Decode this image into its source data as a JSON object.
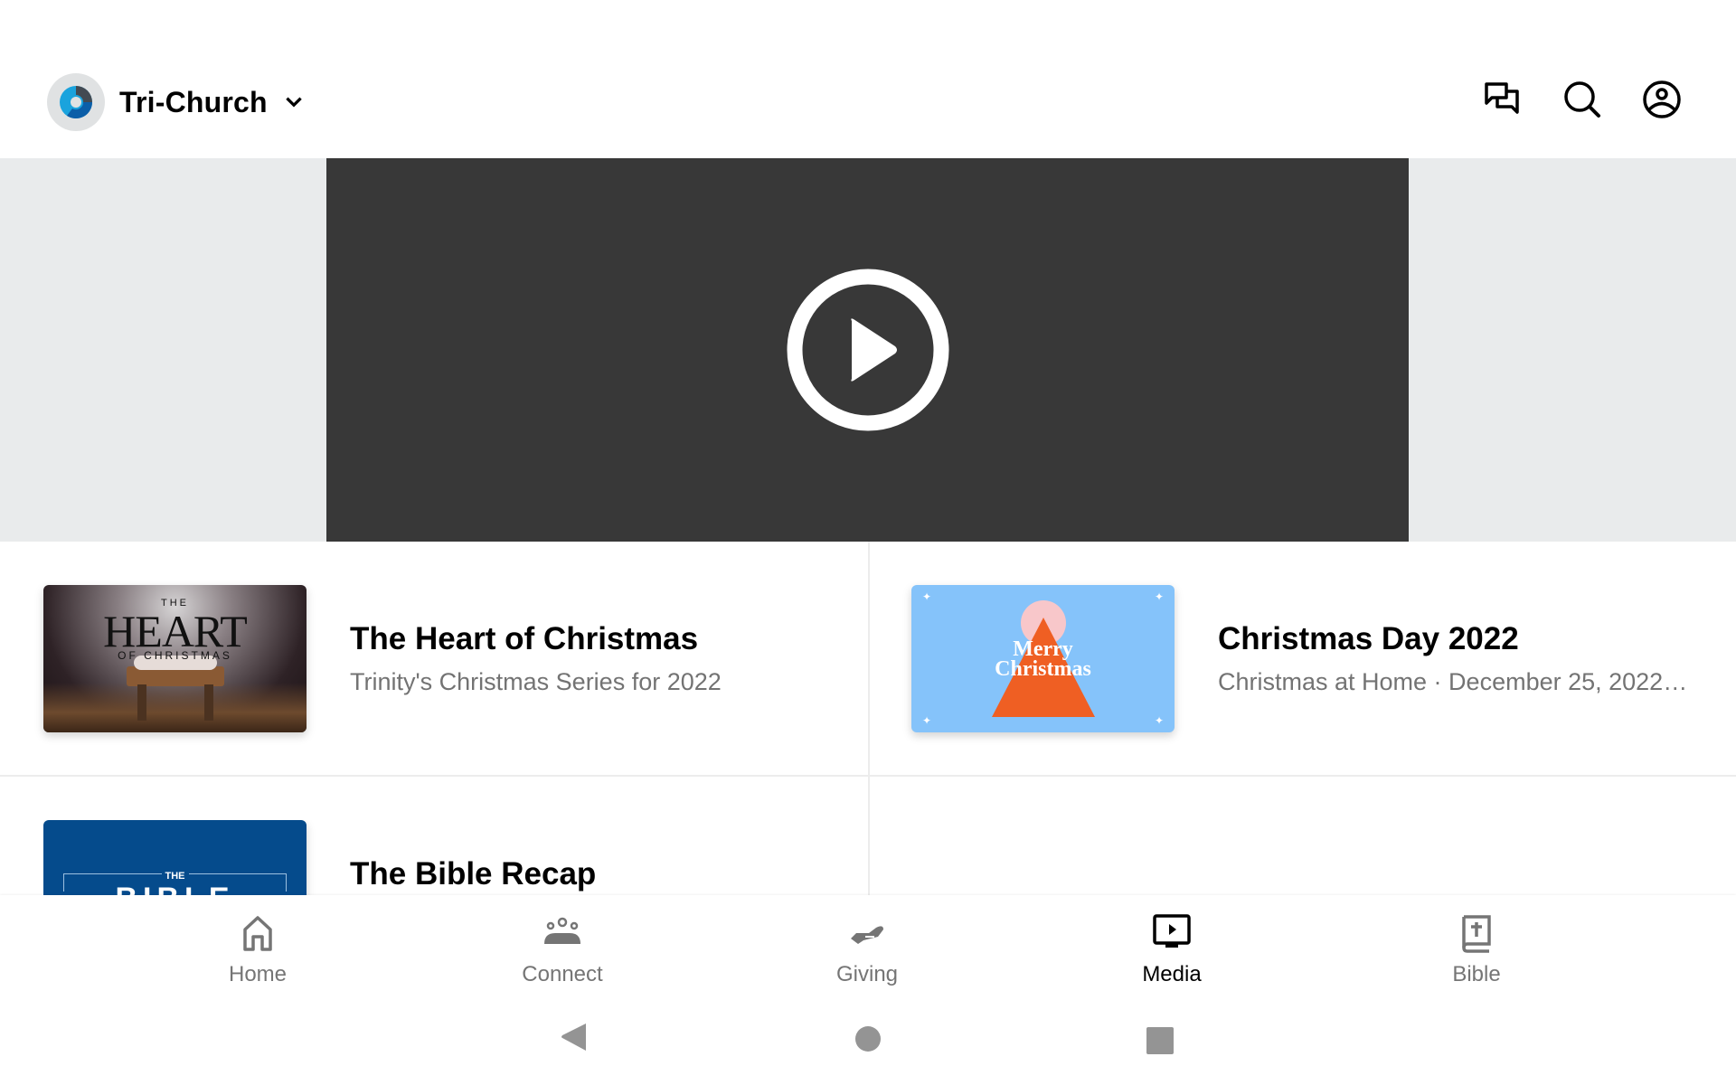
{
  "header": {
    "church_name": "Tri-Church",
    "logo_icon": "church-logo-icon",
    "dropdown_icon": "chevron-down-icon",
    "actions": [
      {
        "name": "messages",
        "icon": "chat-bubbles-icon"
      },
      {
        "name": "search",
        "icon": "search-icon"
      },
      {
        "name": "profile",
        "icon": "user-circle-icon"
      }
    ]
  },
  "hero": {
    "play_icon": "play-circle-icon",
    "bg_color": "#383838"
  },
  "media_items": [
    {
      "title": "The Heart of Christmas",
      "subtitle": "Trinity's Christmas Series for 2022",
      "thumb": {
        "small": "THE",
        "big": "HEART",
        "sub": "OF CHRISTMAS"
      }
    },
    {
      "title": "Christmas Day 2022",
      "subtitle": "Christmas at Home · December 25, 2022…",
      "thumb": {
        "line1": "Merry",
        "line2": "Christmas",
        "bg": "#85c3fa",
        "tree": "#ef5f23",
        "star": "#f8c7ca"
      }
    },
    {
      "title": "The Bible Recap",
      "subtitle": "",
      "thumb": {
        "small": "THE",
        "big": "BIBLE RECAP",
        "bg": "#054b8c"
      }
    }
  ],
  "bottom_nav": {
    "active": "Media",
    "items": [
      {
        "label": "Home",
        "icon": "home-icon"
      },
      {
        "label": "Connect",
        "icon": "people-icon"
      },
      {
        "label": "Giving",
        "icon": "giving-hand-icon"
      },
      {
        "label": "Media",
        "icon": "media-tv-icon"
      },
      {
        "label": "Bible",
        "icon": "bible-icon"
      }
    ]
  },
  "system_nav": [
    "back",
    "home",
    "recents"
  ]
}
